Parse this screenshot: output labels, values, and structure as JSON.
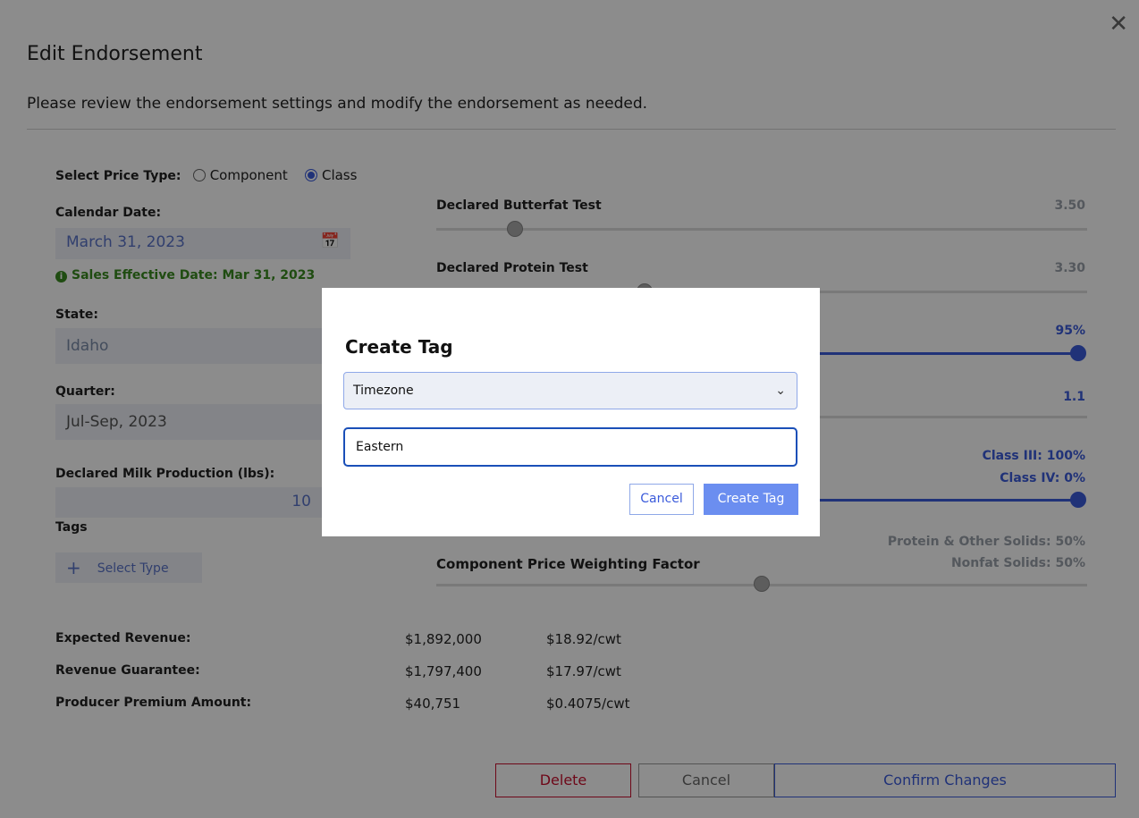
{
  "dialog": {
    "title": "Edit Endorsement",
    "subtitle": "Please review the endorsement settings and modify the endorsement as needed."
  },
  "form": {
    "price_type_label": "Select Price Type:",
    "price_type_options": [
      "Component",
      "Class"
    ],
    "price_type_selected": "Class",
    "calendar_date_label": "Calendar Date:",
    "calendar_date_value": "March 31, 2023",
    "sales_effective": "Sales Effective Date: Mar 31, 2023",
    "state_label": "State:",
    "state_value": "Idaho",
    "quarter_label": "Quarter:",
    "quarter_value": "Jul-Sep, 2023",
    "milk_label": "Declared Milk Production (lbs):",
    "milk_value": "10",
    "tags_label": "Tags",
    "select_type_label": "Select Type"
  },
  "sliders": {
    "butterfat_label": "Declared Butterfat Test",
    "butterfat_value": "3.50",
    "protein_label": "Declared Protein Test",
    "protein_value": "3.30",
    "coverage_value": "95%",
    "protection_value": "1.1",
    "class3_value": "Class III: 100%",
    "class4_value": "Class IV: 0%",
    "protein_solids_value": "Protein & Other Solids: 50%",
    "nonfat_value": "Nonfat Solids: 50%",
    "component_weighting_label": "Component Price Weighting Factor"
  },
  "summary": {
    "rows": [
      {
        "label": "Expected Revenue:",
        "total": "$1,892,000",
        "per_cwt": "$18.92/cwt"
      },
      {
        "label": "Revenue Guarantee:",
        "total": "$1,797,400",
        "per_cwt": "$17.97/cwt"
      },
      {
        "label": "Producer Premium Amount:",
        "total": "$40,751",
        "per_cwt": "$0.4075/cwt"
      }
    ]
  },
  "footer": {
    "delete_label": "Delete",
    "cancel_label": "Cancel",
    "confirm_label": "Confirm Changes"
  },
  "modal": {
    "title": "Create Tag",
    "select_value": "Timezone",
    "input_value": "Eastern",
    "cancel_label": "Cancel",
    "create_label": "Create Tag"
  },
  "colors": {
    "accent": "#3b5bdb",
    "danger": "#c8102e",
    "success": "#3a8a20",
    "overlay": "rgba(0,0,0,0.45)"
  }
}
